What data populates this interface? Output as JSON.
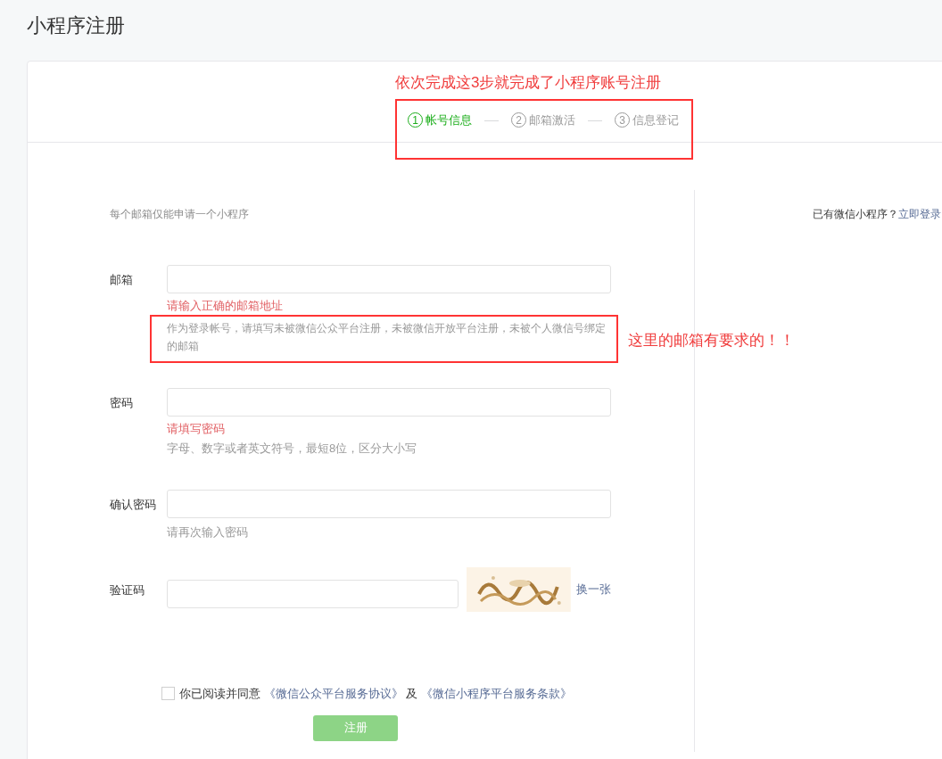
{
  "page_title": "小程序注册",
  "steps": [
    {
      "number": "1",
      "label": "帐号信息",
      "selected": true
    },
    {
      "number": "2",
      "label": "邮箱激活",
      "selected": false
    },
    {
      "number": "3",
      "label": "信息登记",
      "selected": false
    }
  ],
  "notice": "每个邮箱仅能申请一个小程序",
  "login_prompt": {
    "text": "已有微信小程序？",
    "link": "立即登录"
  },
  "fields": [
    {
      "kind": "text",
      "label": "邮箱",
      "error": "请输入正确的邮箱地址",
      "hint": "作为登录帐号，请填写未被微信公众平台注册，未被微信开放平台注册，未被个人微信号绑定的邮箱"
    },
    {
      "kind": "text",
      "label": "密码",
      "error": "请填写密码",
      "hint": "字母、数字或者英文符号，最短8位，区分大小写"
    },
    {
      "kind": "text",
      "label": "确认密码",
      "hint": "请再次输入密码"
    },
    {
      "kind": "captcha",
      "label": "验证码",
      "link": "换一张"
    }
  ],
  "agreement": {
    "checked": false,
    "text": "你已阅读并同意",
    "links": [
      "《微信公众平台服务协议》",
      "《微信小程序平台服务条款》"
    ],
    "joiner": "及"
  },
  "submit": {
    "label": "注册",
    "disabled": true
  },
  "annotations": [
    "依次完成这3步就完成了小程序账号注册",
    "这里的邮箱有要求的！！"
  ]
}
